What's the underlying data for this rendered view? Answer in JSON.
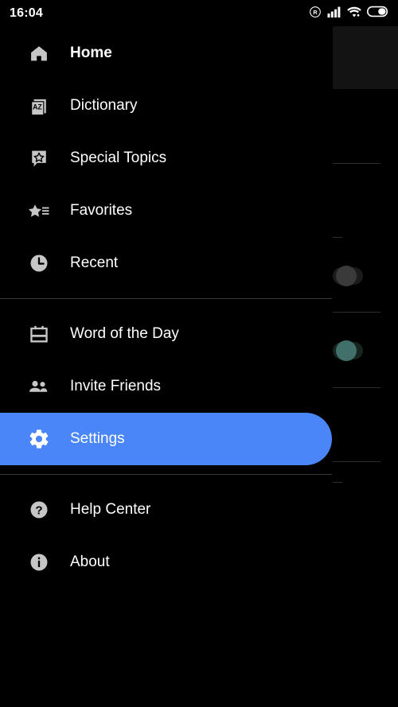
{
  "status_bar": {
    "time": "16:04",
    "icons": [
      {
        "name": "roaming-r-icon",
        "label": "R"
      },
      {
        "name": "cellular-signal-icon",
        "label": "signal"
      },
      {
        "name": "wifi-icon",
        "label": "wifi"
      },
      {
        "name": "battery-icon",
        "label": "battery"
      }
    ]
  },
  "drawer": {
    "groups": [
      {
        "items": [
          {
            "label": "Home",
            "icon": "home-icon",
            "state": "current",
            "name": "drawer-item-home"
          },
          {
            "label": "Dictionary",
            "icon": "dictionary-az-book-icon",
            "state": "normal",
            "name": "drawer-item-dictionary"
          },
          {
            "label": "Special Topics",
            "icon": "star-speech-bubble-icon",
            "state": "normal",
            "name": "drawer-item-special-topics"
          },
          {
            "label": "Favorites",
            "icon": "star-list-icon",
            "state": "normal",
            "name": "drawer-item-favorites"
          },
          {
            "label": "Recent",
            "icon": "clock-icon",
            "state": "normal",
            "name": "drawer-item-recent"
          }
        ]
      },
      {
        "items": [
          {
            "label": "Word of the Day",
            "icon": "calendar-icon",
            "state": "normal",
            "name": "drawer-item-word-of-the-day"
          },
          {
            "label": "Invite Friends",
            "icon": "people-group-icon",
            "state": "normal",
            "name": "drawer-item-invite-friends"
          },
          {
            "label": "Settings",
            "icon": "gear-icon",
            "state": "active",
            "name": "drawer-item-settings"
          }
        ]
      },
      {
        "items": [
          {
            "label": "Help Center",
            "icon": "question-mark-circle-icon",
            "state": "normal",
            "name": "drawer-item-help-center"
          },
          {
            "label": "About",
            "icon": "info-circle-icon",
            "state": "normal",
            "name": "drawer-item-about"
          }
        ]
      }
    ]
  },
  "background_screen": {
    "card": {
      "name": "settings-header-card"
    },
    "toggles": [
      {
        "name": "settings-toggle-off",
        "state": "off"
      },
      {
        "name": "settings-toggle-on",
        "state": "on"
      }
    ]
  },
  "colors": {
    "accent_blue": "#4a86f7",
    "icon_gray": "#c6c6c6",
    "text_white": "#ffffff",
    "divider": "#3a3a3a",
    "bg_black": "#000000",
    "card_dark": "#131313",
    "toggle_off_thumb": "#3a3a3a",
    "toggle_on_thumb": "#41706a"
  }
}
